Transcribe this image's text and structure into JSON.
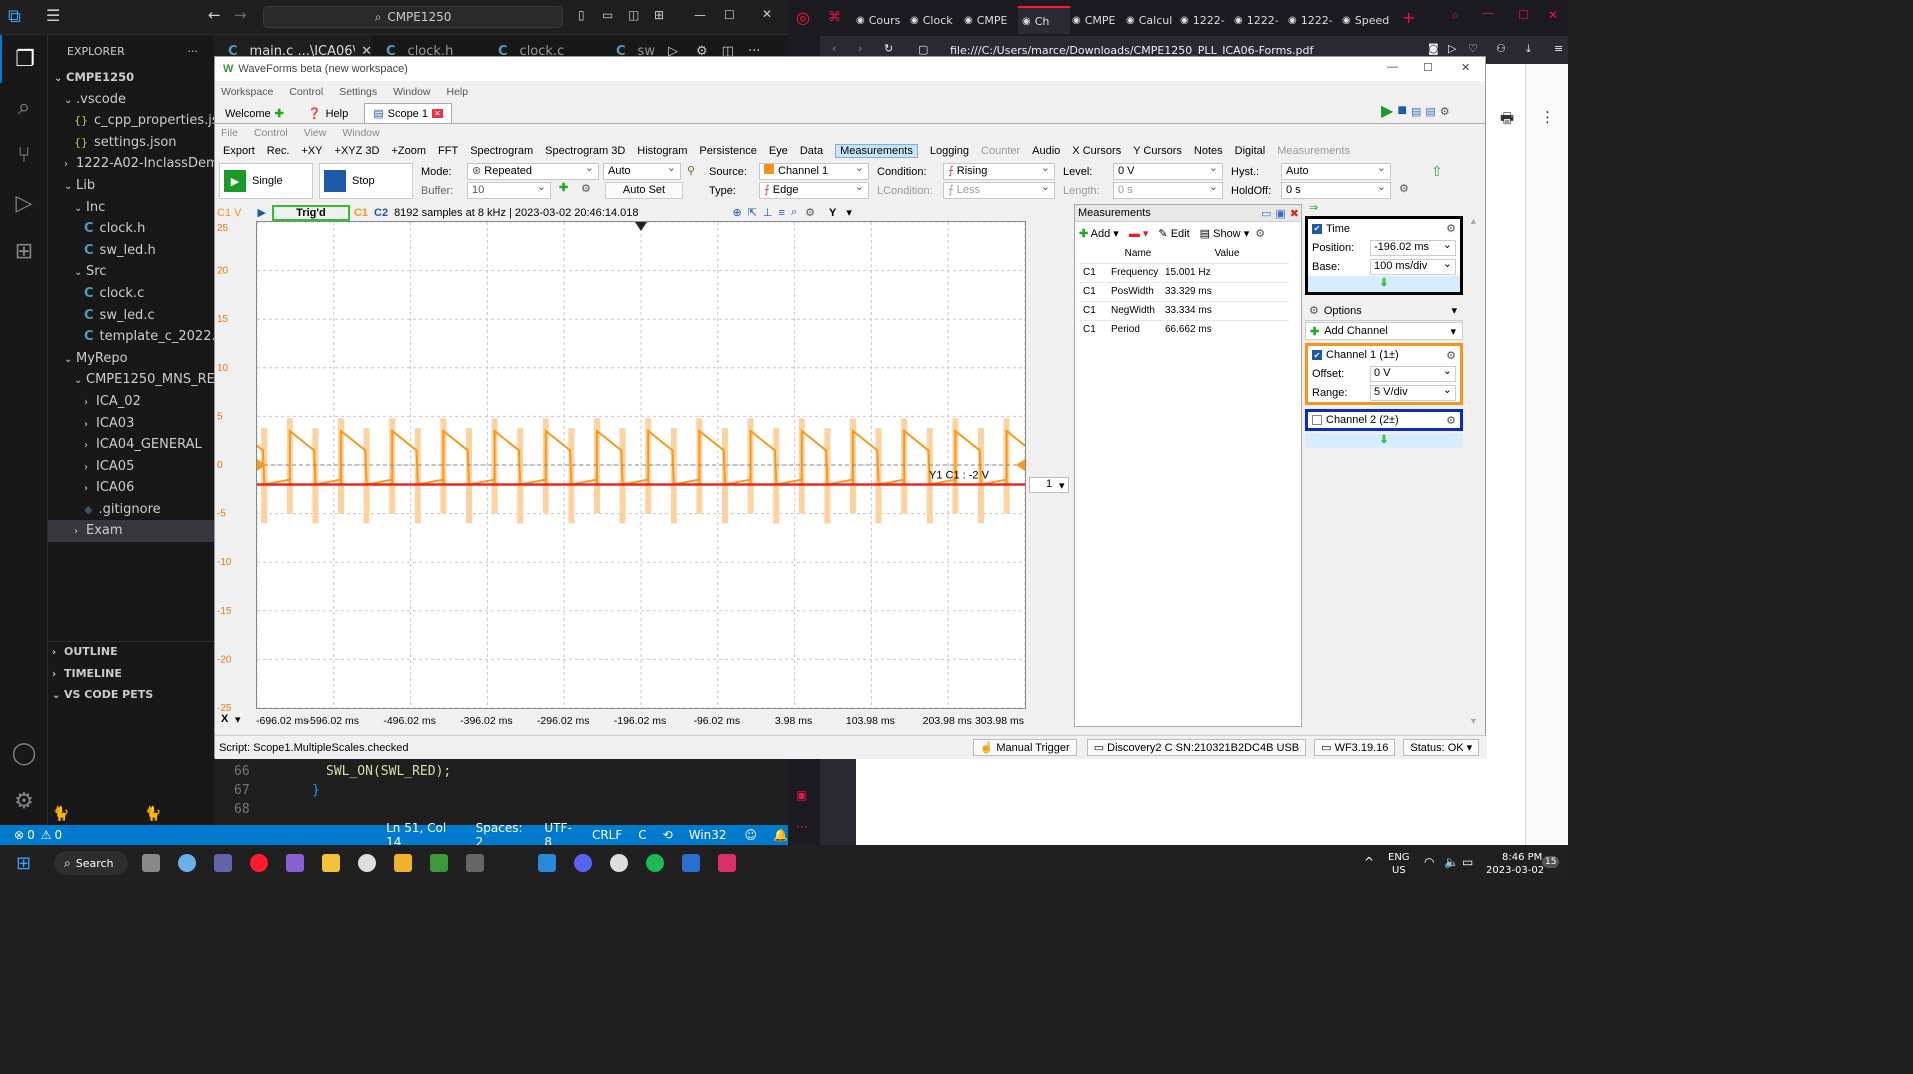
{
  "vscode": {
    "title_search": "CMPE1250",
    "explorer_label": "EXPLORER",
    "root": "CMPE1250",
    "tree": [
      {
        "label": ".vscode",
        "indent": 1,
        "type": "folder-open"
      },
      {
        "label": "c_cpp_properties.json",
        "indent": 2,
        "type": "json"
      },
      {
        "label": "settings.json",
        "indent": 2,
        "type": "json"
      },
      {
        "label": "1222-A02-InclassDem...",
        "indent": 1,
        "type": "folder"
      },
      {
        "label": "Lib",
        "indent": 1,
        "type": "folder-open"
      },
      {
        "label": "Inc",
        "indent": 2,
        "type": "folder-open"
      },
      {
        "label": "clock.h",
        "indent": 3,
        "type": "c"
      },
      {
        "label": "sw_led.h",
        "indent": 3,
        "type": "c"
      },
      {
        "label": "Src",
        "indent": 2,
        "type": "folder-open"
      },
      {
        "label": "clock.c",
        "indent": 3,
        "type": "c"
      },
      {
        "label": "sw_led.c",
        "indent": 3,
        "type": "c"
      },
      {
        "label": "template_c_2022.c",
        "indent": 3,
        "type": "c"
      },
      {
        "label": "MyRepo",
        "indent": 1,
        "type": "folder-open"
      },
      {
        "label": "CMPE1250_MNS_RE...",
        "indent": 2,
        "type": "folder-open"
      },
      {
        "label": "ICA_02",
        "indent": 3,
        "type": "folder"
      },
      {
        "label": "ICA03",
        "indent": 3,
        "type": "folder"
      },
      {
        "label": "ICA04_GENERAL",
        "indent": 3,
        "type": "folder"
      },
      {
        "label": "ICA05",
        "indent": 3,
        "type": "folder"
      },
      {
        "label": "ICA06",
        "indent": 3,
        "type": "folder"
      },
      {
        "label": ".gitignore",
        "indent": 3,
        "type": "git"
      },
      {
        "label": "Exam",
        "indent": 2,
        "type": "folder"
      }
    ],
    "sections": [
      "OUTLINE",
      "TIMELINE",
      "VS CODE PETS"
    ],
    "editor_tabs": [
      "main.c ...\\ICA06\\...",
      "clock.h",
      "clock.c",
      "sw"
    ],
    "code_lines": [
      {
        "n": "66",
        "code": "SWL_ON(SWL_RED);"
      },
      {
        "n": "67",
        "code": "}"
      },
      {
        "n": "68",
        "code": ""
      }
    ],
    "status": {
      "errors": "0",
      "warnings": "0",
      "position": "Ln 51, Col 14",
      "spaces": "Spaces: 2",
      "encoding": "UTF-8",
      "eol": "CRLF",
      "lang": "C",
      "platform": "Win32"
    }
  },
  "browser": {
    "tabs": [
      "Cours",
      "Clock",
      "CMPE",
      "Ch",
      "CMPE",
      "Calcul",
      "1222-",
      "1222-",
      "1222-",
      "Speed"
    ],
    "url": "file:///C:/Users/marce/Downloads/CMPE1250_PLL_ICA06-Forms.pdf"
  },
  "waveforms": {
    "title": "WaveForms beta (new workspace)",
    "menu": [
      "Workspace",
      "Control",
      "Settings",
      "Window",
      "Help"
    ],
    "tabs": [
      "Welcome",
      "Help",
      "Scope 1"
    ],
    "submenu": [
      "File",
      "Control",
      "View",
      "Window"
    ],
    "toolbar": [
      "Export",
      "Rec.",
      "+XY",
      "+XYZ 3D",
      "+Zoom",
      "FFT",
      "Spectrogram",
      "Spectrogram 3D",
      "Histogram",
      "Persistence",
      "Eye",
      "Data",
      "Measurements",
      "Logging",
      "Counter",
      "Audio",
      "X Cursors",
      "Y Cursors",
      "Notes",
      "Digital",
      "Measurements"
    ],
    "single": "Single",
    "stop": "Stop",
    "mode_label": "Mode:",
    "mode": "Repeated",
    "auto": "Auto",
    "buffer_label": "Buffer:",
    "buffer": "10",
    "autoset": "Auto Set",
    "source_label": "Source:",
    "source": "Channel 1",
    "type_label": "Type:",
    "type": "Edge",
    "condition_label": "Condition:",
    "condition": "Rising",
    "lcondition_label": "LCondition:",
    "lcondition": "Less",
    "level_label": "Level:",
    "level": "0 V",
    "length_label": "Length:",
    "length": "0 s",
    "hyst_label": "Hyst.:",
    "hyst": "Auto",
    "holdoff_label": "HoldOff:",
    "holdoff": "0 s",
    "plot_header": {
      "ch": "C1 V",
      "trig": "Trig'd",
      "c1": "C1",
      "c2": "C2",
      "info": "8192 samples at 8 kHz | 2023-03-02 20:46:14.018",
      "y": "Y"
    },
    "cursor_label": "Y1 C1 : -2 V",
    "side_value": "1",
    "x_button": "X",
    "measurements": {
      "title": "Measurements",
      "add": "Add",
      "edit": "Edit",
      "show": "Show",
      "col_name": "Name",
      "col_value": "Value",
      "rows": [
        {
          "ch": "C1",
          "name": "Frequency",
          "value": "15.001 Hz"
        },
        {
          "ch": "C1",
          "name": "PosWidth",
          "value": "33.329 ms"
        },
        {
          "ch": "C1",
          "name": "NegWidth",
          "value": "33.334 ms"
        },
        {
          "ch": "C1",
          "name": "Period",
          "value": "66.662 ms"
        }
      ]
    },
    "time": {
      "label": "Time",
      "pos_label": "Position:",
      "pos": "-196.02 ms",
      "base_label": "Base:",
      "base": "100 ms/div"
    },
    "options": "Options",
    "add_channel": "Add Channel",
    "ch1": {
      "label": "Channel 1 (1±)",
      "offset_label": "Offset:",
      "offset": "0 V",
      "range_label": "Range:",
      "range": "5 V/div"
    },
    "ch2": {
      "label": "Channel 2 (2±)"
    },
    "script": "Script: Scope1.MultipleScales.checked",
    "manual_trigger": "Manual Trigger",
    "device": "Discovery2 C SN:210321B2DC4B USB",
    "version": "WF3.19.16",
    "status": "Status: OK"
  },
  "chart_data": {
    "type": "line",
    "ylabel": "C1 V",
    "ylim": [
      -25,
      25
    ],
    "y_ticks": [
      "25",
      "20",
      "15",
      "10",
      "5",
      "0",
      "-5",
      "-10",
      "-15",
      "-20",
      "-25"
    ],
    "x_ticks": [
      "-696.02 ms",
      "-596.02 ms",
      "-496.02 ms",
      "-396.02 ms",
      "-296.02 ms",
      "-196.02 ms",
      "-96.02 ms",
      "3.98 ms",
      "103.98 ms",
      "203.98 ms",
      "303.98 ms"
    ],
    "xlim_ms": [
      -696.02,
      303.98
    ],
    "series": [
      {
        "name": "C1",
        "color": "#f39a1f",
        "frequency_hz": 15.001,
        "period_ms": 66.662,
        "high_v": 2.5,
        "low_v": -2
      }
    ],
    "cursor": {
      "value_v": -2,
      "color": "#e8281e"
    }
  },
  "taskbar": {
    "search": "Search",
    "lang1": "ENG",
    "lang2": "US",
    "time": "8:46 PM",
    "date": "2023-03-02",
    "badge": "15"
  }
}
